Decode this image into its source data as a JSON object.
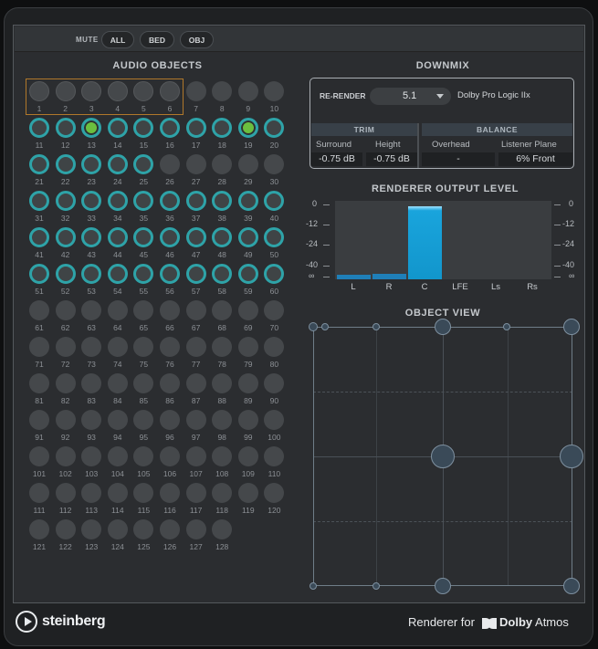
{
  "mute": {
    "label": "MUTE",
    "buttons": [
      "ALL",
      "BED",
      "OBJ"
    ]
  },
  "audio_objects": {
    "title": "AUDIO OBJECTS",
    "total": 128,
    "bed_objects": [
      1,
      2,
      3,
      4,
      5,
      6
    ],
    "active_objects": [
      11,
      12,
      13,
      14,
      15,
      16,
      17,
      18,
      19,
      20,
      21,
      22,
      23,
      24,
      25,
      31,
      32,
      33,
      34,
      35,
      36,
      37,
      38,
      39,
      40,
      41,
      42,
      43,
      44,
      45,
      46,
      47,
      48,
      49,
      50,
      51,
      52,
      53,
      54,
      55,
      56,
      57,
      58,
      59,
      60
    ],
    "highlighted_objects": [
      13,
      19
    ],
    "colors": {
      "active_ring": "#2ea3a8",
      "highlight": "#6bbf3f",
      "bed_outline": "#b0782a"
    }
  },
  "downmix": {
    "title": "DOWNMIX",
    "rerender_label": "RE-RENDER",
    "format": "5.1",
    "mode": "Dolby Pro Logic IIx",
    "trim": {
      "header": "TRIM",
      "surround_label": "Surround",
      "surround_value": "-0.75 dB",
      "height_label": "Height",
      "height_value": "-0.75 dB"
    },
    "balance": {
      "header": "BALANCE",
      "overhead_label": "Overhead",
      "overhead_value": "-",
      "listener_label": "Listener Plane",
      "listener_value": "6% Front"
    }
  },
  "renderer_output": {
    "title": "RENDERER OUTPUT LEVEL",
    "scale_labels": [
      "0",
      "-12",
      "-24",
      "-40",
      "∞"
    ],
    "scale_labels_right": [
      "0",
      "-12",
      "-24",
      "-40",
      "∞"
    ],
    "channels": [
      "L",
      "R",
      "C",
      "LFE",
      "Ls",
      "Rs"
    ],
    "levels_db": [
      -60,
      -58,
      -1,
      null,
      null,
      null
    ],
    "color": "#19a4dc"
  },
  "object_view": {
    "title": "OBJECT VIEW"
  },
  "footer": {
    "brand": "steinberg",
    "renderer_for": "Renderer for",
    "dolby_bold": "Dolby",
    "dolby_rest": " Atmos"
  }
}
